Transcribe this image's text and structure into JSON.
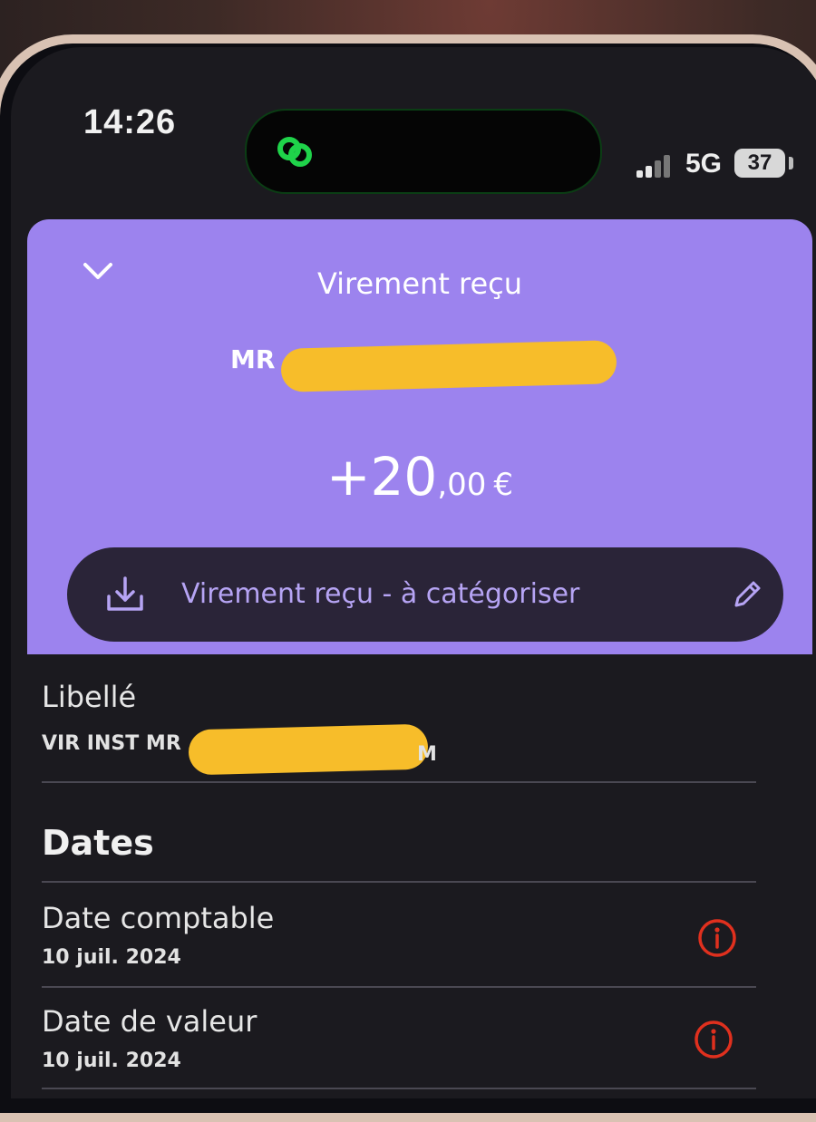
{
  "status_bar": {
    "time": "14:26",
    "network": "5G",
    "battery": "37"
  },
  "colors": {
    "card_purple": "#9c83ee",
    "pill_dark": "#2a2438",
    "accent_text": "#b6a4f4",
    "info_red": "#e0301e",
    "redaction_yellow": "#f7bd2a"
  },
  "header": {
    "collapse_icon": "chevron-down-icon",
    "title": "Virement reçu",
    "counterparty": "MR",
    "amount_main": "+20",
    "amount_decimals": ",00",
    "currency": "€"
  },
  "category": {
    "icon": "download-tray-icon",
    "label": "Virement reçu - à catégoriser",
    "edit_icon": "pencil-icon"
  },
  "libelle": {
    "label": "Libellé",
    "value_prefix": "VIR INST MR",
    "value_suffix": "M"
  },
  "dates": {
    "heading": "Dates",
    "items": [
      {
        "label": "Date comptable",
        "value": "10 juil. 2024",
        "icon": "info-icon"
      },
      {
        "label": "Date de valeur",
        "value": "10 juil. 2024",
        "icon": "info-icon"
      }
    ]
  }
}
